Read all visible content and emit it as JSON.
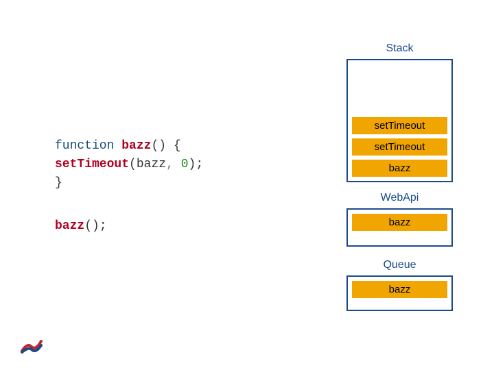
{
  "code": {
    "kw_function": "function",
    "fname": "bazz",
    "open_paren1": "()",
    "open_brace": " {",
    "indent": "  ",
    "call_fn": "setTimeout",
    "open_paren2": "(",
    "arg_ref": "bazz",
    "comma": ",",
    "space": " ",
    "arg_num": "0",
    "close_paren2": ")",
    "semi": ";",
    "close_brace": "}",
    "invoke_fn": "bazz",
    "invoke_parens": "();"
  },
  "panels": {
    "stack": {
      "title": "Stack",
      "frames": [
        "setTimeout",
        "setTimeout",
        "bazz"
      ]
    },
    "webapi": {
      "title": "WebApi",
      "frames": [
        "bazz"
      ]
    },
    "queue": {
      "title": "Queue",
      "frames": [
        "bazz"
      ]
    }
  }
}
